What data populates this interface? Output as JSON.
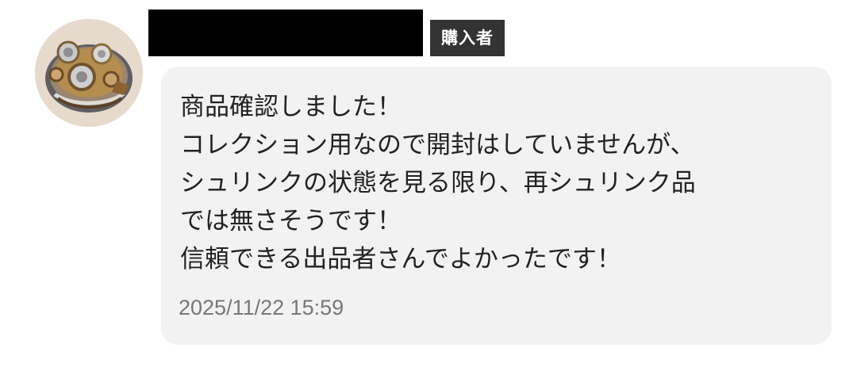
{
  "user": {
    "avatar_icon": "steampunk-gear-avatar",
    "name_redacted": true,
    "role_badge": "購入者"
  },
  "message": {
    "lines": [
      "商品確認しました！",
      "コレクション用なので開封はしていませんが、",
      "シュリンクの状態を見る限り、再シュリンク品",
      "では無さそうです！",
      "信頼できる出品者さんでよかったです！"
    ],
    "timestamp": "2025/11/22 15:59"
  },
  "colors": {
    "bubble_background": "#f2f2f2",
    "badge_background": "#333333",
    "redaction": "#000000",
    "message_text": "#222222",
    "timestamp_text": "#777777"
  }
}
